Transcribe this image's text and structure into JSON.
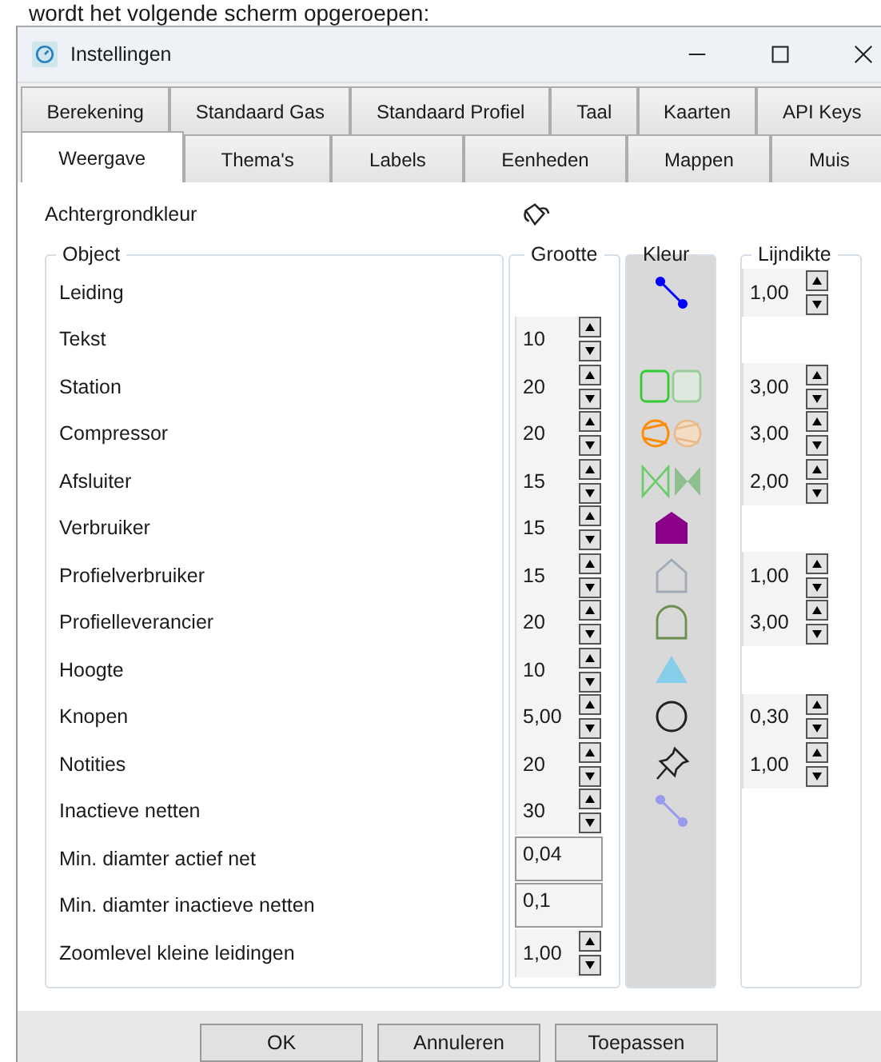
{
  "caption": "wordt het volgende scherm opgeroepen:",
  "window": {
    "title": "Instellingen"
  },
  "tab_rows": [
    [
      {
        "label": "Berekening",
        "selected": false
      },
      {
        "label": "Standaard Gas",
        "selected": false
      },
      {
        "label": "Standaard Profiel",
        "selected": false
      },
      {
        "label": "Taal",
        "selected": false
      },
      {
        "label": "Kaarten",
        "selected": false
      },
      {
        "label": "API Keys",
        "selected": false
      }
    ],
    [
      {
        "label": "Weergave",
        "selected": true
      },
      {
        "label": "Thema's",
        "selected": false
      },
      {
        "label": "Labels",
        "selected": false
      },
      {
        "label": "Eenheden",
        "selected": false
      },
      {
        "label": "Mappen",
        "selected": false
      },
      {
        "label": "Muis",
        "selected": false
      }
    ]
  ],
  "background_color_label": "Achtergrondkleur",
  "headers": [
    "Object",
    "Grootte",
    "Kleur",
    "Lijndikte"
  ],
  "rows": [
    {
      "name": "Leiding",
      "symbol": {
        "kind": "line",
        "color": "#0000ff"
      },
      "thickness": "1,00"
    },
    {
      "name": "Tekst",
      "size": {
        "kind": "spin",
        "value": "10"
      }
    },
    {
      "name": "Station",
      "size": {
        "kind": "spin",
        "value": "20"
      },
      "symbol": {
        "kind": "station",
        "color": "#33cc33"
      },
      "thickness": "3,00"
    },
    {
      "name": "Compressor",
      "size": {
        "kind": "spin",
        "value": "20"
      },
      "symbol": {
        "kind": "compressor",
        "color": "#ff8c00"
      },
      "thickness": "3,00"
    },
    {
      "name": "Afsluiter",
      "size": {
        "kind": "spin",
        "value": "15"
      },
      "symbol": {
        "kind": "valve",
        "color": "#66cc66"
      },
      "thickness": "2,00"
    },
    {
      "name": "Verbruiker",
      "size": {
        "kind": "spin",
        "value": "15"
      },
      "symbol": {
        "kind": "house",
        "color": "#8b008b"
      }
    },
    {
      "name": "Profielverbruiker",
      "size": {
        "kind": "spin",
        "value": "15"
      },
      "symbol": {
        "kind": "outline",
        "color": "#a0aab4"
      },
      "thickness": "1,00"
    },
    {
      "name": "Profielleverancier",
      "size": {
        "kind": "spin",
        "value": "20"
      },
      "symbol": {
        "kind": "arch",
        "color": "#6b8e4e"
      },
      "thickness": "3,00"
    },
    {
      "name": "Hoogte",
      "size": {
        "kind": "spin",
        "value": "10"
      },
      "symbol": {
        "kind": "triangle",
        "color": "#87ceeb"
      }
    },
    {
      "name": "Knopen",
      "size": {
        "kind": "spin",
        "value": "5,00"
      },
      "symbol": {
        "kind": "circle",
        "color": "#222222"
      },
      "thickness": "0,30"
    },
    {
      "name": "Notities",
      "size": {
        "kind": "spin",
        "value": "20"
      },
      "symbol": {
        "kind": "pin",
        "color": "#222222"
      },
      "thickness": "1,00"
    },
    {
      "name": "Inactieve netten",
      "size": {
        "kind": "spin",
        "value": "30"
      },
      "symbol": {
        "kind": "line",
        "color": "#9999ee"
      }
    },
    {
      "name": "Min. diamter actief net",
      "size": {
        "kind": "text",
        "value": "0,04"
      }
    },
    {
      "name": "Min. diamter inactieve netten",
      "size": {
        "kind": "text",
        "value": "0,1"
      }
    },
    {
      "name": "Zoomlevel kleine leidingen",
      "size": {
        "kind": "spin",
        "value": "1,00"
      }
    }
  ],
  "buttons": [
    "OK",
    "Annuleren",
    "Toepassen"
  ]
}
